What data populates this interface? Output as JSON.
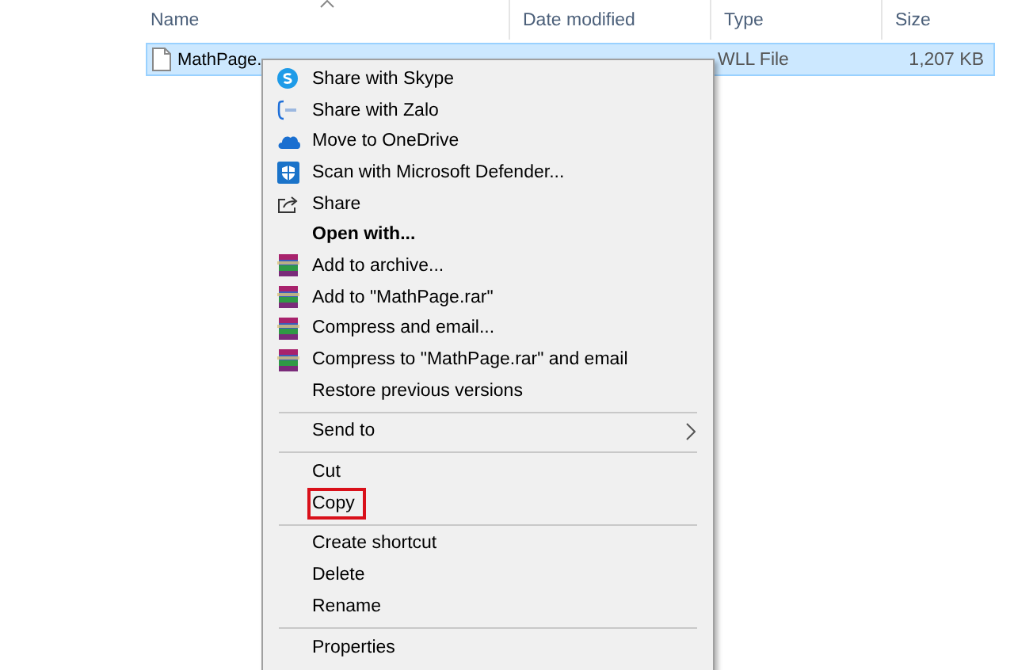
{
  "columns": [
    {
      "label": "Name"
    },
    {
      "label": "Date modified"
    },
    {
      "label": "Type"
    },
    {
      "label": "Size"
    }
  ],
  "file": {
    "name": "MathPage.",
    "type": "WLL File",
    "size": "1,207 KB",
    "selected": true
  },
  "menu": {
    "groups": [
      {
        "items": [
          {
            "label": "Share with Skype",
            "kind": "skype"
          },
          {
            "label": "Share with Zalo",
            "kind": "zalo"
          },
          {
            "label": "Move to OneDrive",
            "kind": "cloud"
          },
          {
            "label": "Scan with Microsoft Defender...",
            "kind": "shield"
          },
          {
            "label": "Share",
            "kind": "share"
          },
          {
            "label": "Open with...",
            "bold": true
          },
          {
            "label": "Add to archive...",
            "kind": "archive"
          },
          {
            "label": "Add to \"MathPage.rar\"",
            "kind": "archive"
          },
          {
            "label": "Compress and email...",
            "kind": "archive"
          },
          {
            "label": "Compress to \"MathPage.rar\" and email",
            "kind": "archive"
          },
          {
            "label": "Restore previous versions"
          }
        ]
      },
      {
        "items": [
          {
            "label": "Send to",
            "submenu": true
          }
        ]
      },
      {
        "items": [
          {
            "label": "Cut"
          },
          {
            "label": "Copy",
            "highlighted": true
          }
        ]
      },
      {
        "items": [
          {
            "label": "Create shortcut"
          },
          {
            "label": "Delete"
          },
          {
            "label": "Rename"
          }
        ]
      },
      {
        "items": [
          {
            "label": "Properties"
          }
        ]
      }
    ]
  }
}
